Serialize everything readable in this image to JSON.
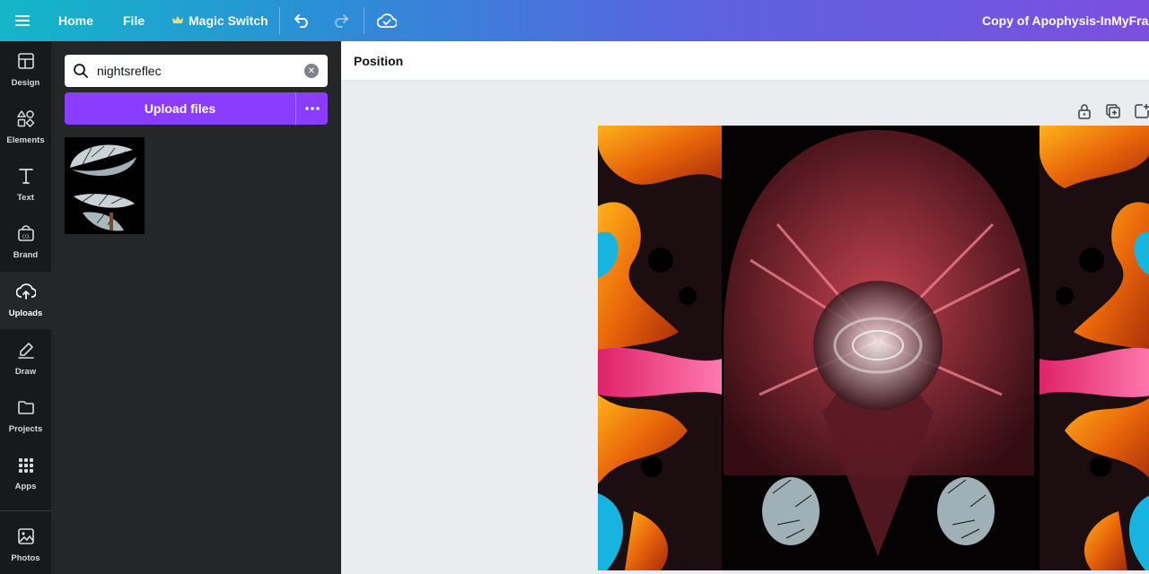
{
  "topbar": {
    "home_label": "Home",
    "file_label": "File",
    "magic_label": "Magic Switch",
    "doc_title": "Copy of Apophysis-InMyFractal"
  },
  "rail": {
    "items": [
      {
        "label": "Design",
        "icon": "layout-icon"
      },
      {
        "label": "Elements",
        "icon": "shapes-icon"
      },
      {
        "label": "Text",
        "icon": "text-icon"
      },
      {
        "label": "Brand",
        "icon": "brand-icon"
      },
      {
        "label": "Uploads",
        "icon": "cloud-upload-icon",
        "active": true
      },
      {
        "label": "Draw",
        "icon": "pen-icon"
      },
      {
        "label": "Projects",
        "icon": "folder-icon"
      },
      {
        "label": "Apps",
        "icon": "apps-grid-icon"
      },
      {
        "label": "Photos",
        "icon": "photo-icon"
      }
    ]
  },
  "panel": {
    "search_value": "nightsreflec",
    "upload_label": "Upload files"
  },
  "context": {
    "position_label": "Position"
  },
  "colors": {
    "accent": "#8b3dff",
    "rail_bg": "#18191b",
    "panel_bg": "#252627"
  }
}
